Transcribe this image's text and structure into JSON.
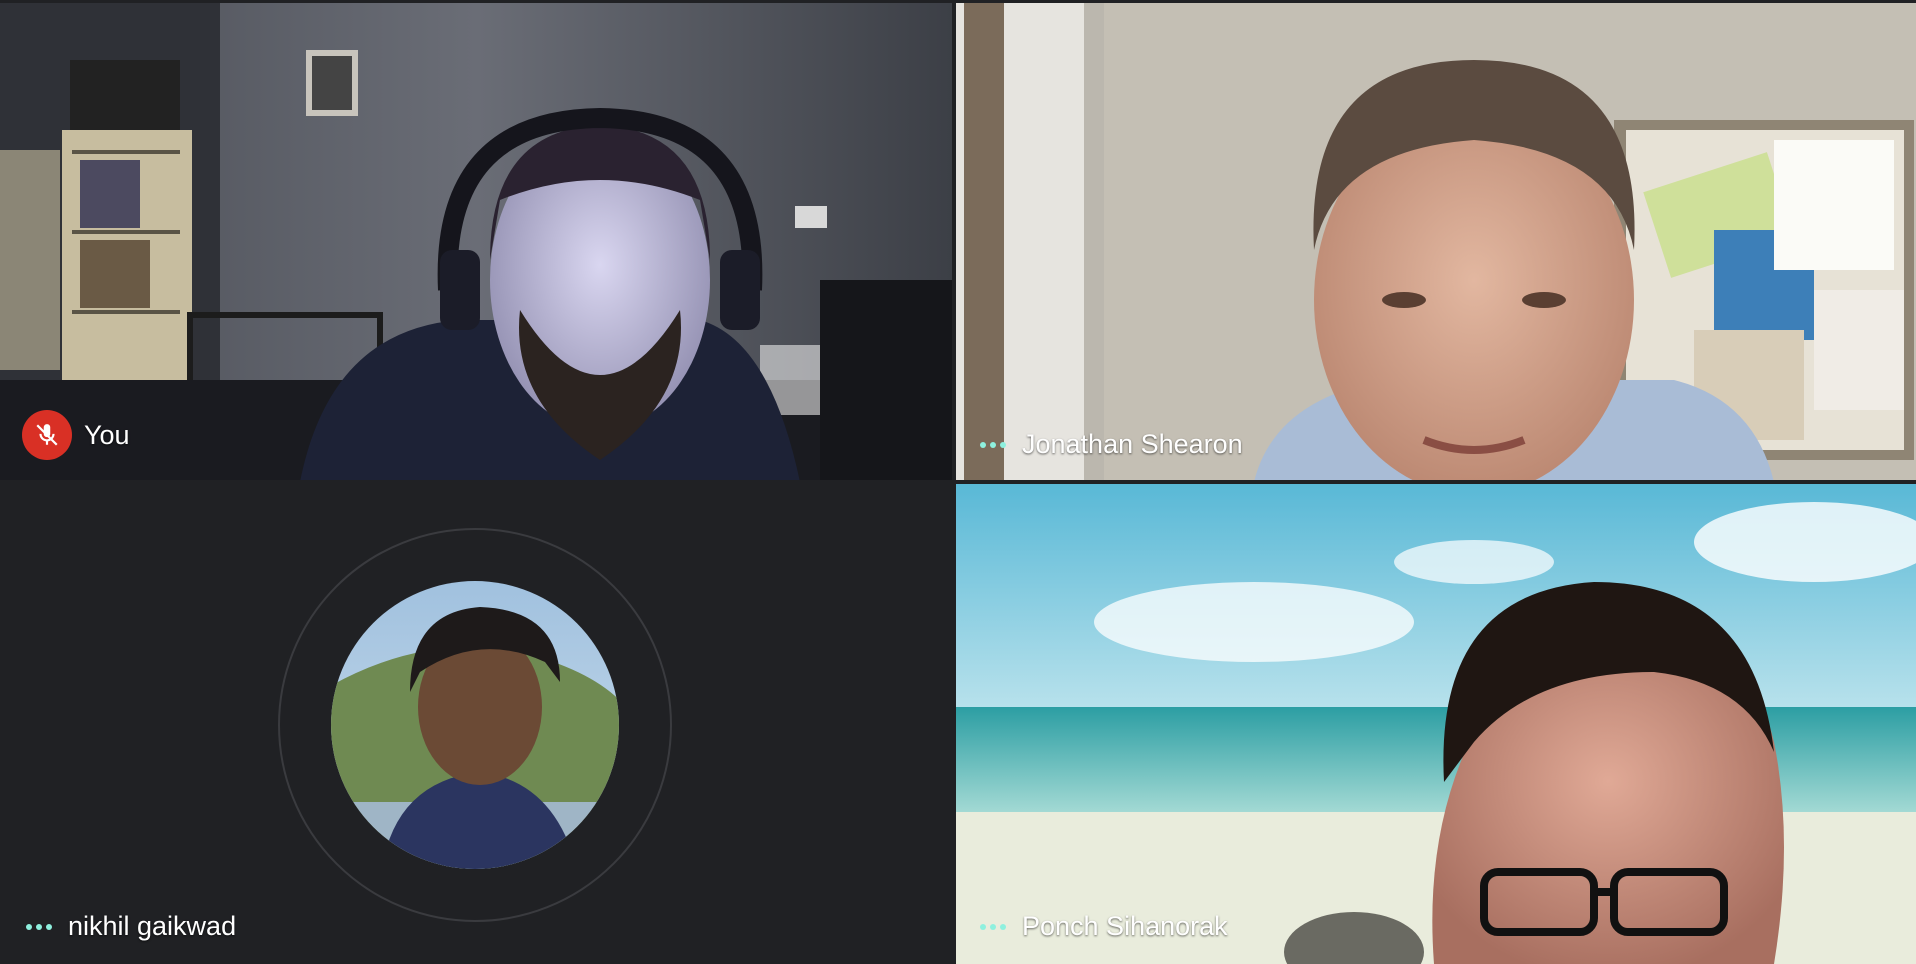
{
  "participants": [
    {
      "name": "You",
      "status_icon": "mic-off-icon",
      "status_color": "#d93025"
    },
    {
      "name": "Jonathan Shearon",
      "status_icon": "more-dots-icon",
      "status_color": "#8ef0de"
    },
    {
      "name": "nikhil gaikwad",
      "status_icon": "more-dots-icon",
      "status_color": "#8ef0de"
    },
    {
      "name": "Ponch Sihanorak",
      "status_icon": "more-dots-icon",
      "status_color": "#8ef0de"
    }
  ],
  "theme": {
    "background": "#202124",
    "text": "#ffffff",
    "accent": "#8ef0de",
    "muted_badge": "#d93025"
  }
}
